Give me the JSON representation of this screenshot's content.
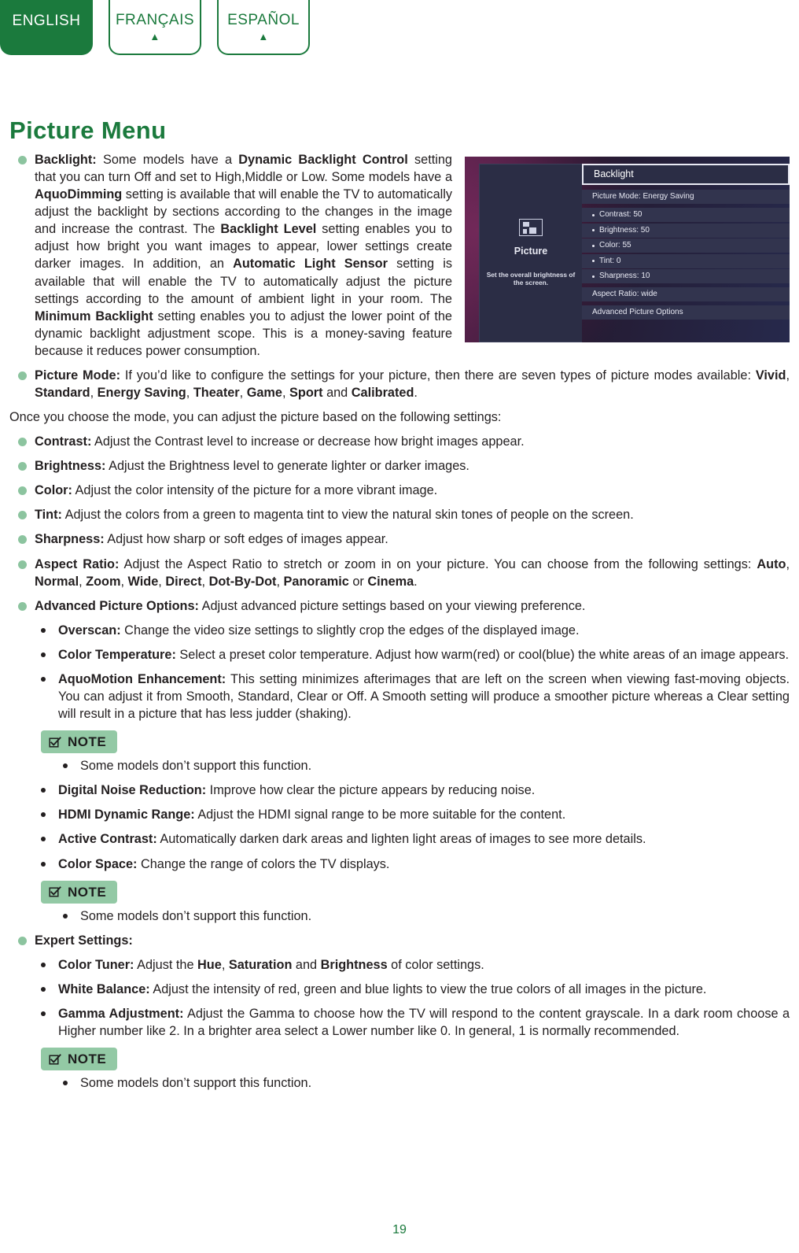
{
  "language_tabs": [
    {
      "label": "ENGLISH",
      "active": true,
      "arrow": "▲"
    },
    {
      "label": "FRANÇAIS",
      "active": false,
      "arrow": "▲"
    },
    {
      "label": "ESPAÑOL",
      "active": false,
      "arrow": "▲"
    }
  ],
  "page": {
    "title": "Picture Menu",
    "number": "19"
  },
  "colors": {
    "brand_green": "#1b7a3d",
    "bullet_green": "#8cc49f",
    "note_badge_bg": "#93c9a5",
    "text": "#231f20"
  },
  "tv_screenshot": {
    "panel_label": "Picture",
    "panel_description": "Set the overall brightness of the screen.",
    "panel_icon": "picture-mode-icon",
    "highlighted_item": "Backlight",
    "rows": [
      {
        "label": "Picture Mode: Energy Saving",
        "bulleted": false,
        "group_start": true
      },
      {
        "label": "Contrast: 50",
        "bulleted": true,
        "group_start": true
      },
      {
        "label": "Brightness: 50",
        "bulleted": true,
        "group_start": false
      },
      {
        "label": "Color: 55",
        "bulleted": true,
        "group_start": false
      },
      {
        "label": "Tint: 0",
        "bulleted": true,
        "group_start": false
      },
      {
        "label": "Sharpness: 10",
        "bulleted": true,
        "group_start": false
      },
      {
        "label": "Aspect Ratio: wide",
        "bulleted": false,
        "group_start": true
      },
      {
        "label": "Advanced Picture Options",
        "bulleted": false,
        "group_start": true
      }
    ]
  },
  "body": {
    "backlight": {
      "term": "Backlight:",
      "text_1": " Some models have a ",
      "bold_1": "Dynamic Backlight Control",
      "text_2": " setting that you can turn Off and set to High,Middle  or Low. Some models have a ",
      "bold_2": "AquoDimming",
      "text_3": " setting is available that will enable the TV to automatically adjust the backlight by sections according to the changes in the image and increase the contrast. The ",
      "bold_3": "Backlight Level",
      "text_4": " setting enables you to adjust how bright you want images to appear, lower settings create darker images. In addition, an ",
      "bold_4": "Automatic Light Sensor",
      "text_5": " setting is available that will enable the TV to automatically adjust the picture settings according to the amount of ambient light in your room. The ",
      "bold_5": "Minimum Backlight",
      "text_6": " setting enables you to adjust the lower point of the dynamic backlight adjustment scope. This is a money-saving feature because it reduces power consumption."
    },
    "picture_mode": {
      "term": "Picture Mode:",
      "text_1": " If you’d like to configure the settings for your picture, then there are seven types of picture modes available: ",
      "modes": [
        "Vivid",
        "Standard",
        "Energy Saving",
        "Theater",
        "Game",
        "Sport",
        "Calibrated"
      ],
      "tail": "."
    },
    "intro_line": "Once you choose the mode, you can adjust the picture based on the following settings:",
    "settings": [
      {
        "term": "Contrast:",
        "text": " Adjust the Contrast level to increase or decrease how bright images appear."
      },
      {
        "term": "Brightness:",
        "text": " Adjust the Brightness level to generate lighter or darker images."
      },
      {
        "term": "Color:",
        "text": " Adjust the color intensity of the picture for a more vibrant image."
      },
      {
        "term": "Tint:",
        "text": " Adjust the colors from a green to magenta tint to view the natural skin tones of people on the screen."
      },
      {
        "term": "Sharpness:",
        "text": " Adjust how sharp or soft edges of images appear."
      }
    ],
    "aspect_ratio": {
      "term": "Aspect Ratio:",
      "text_1": " Adjust the Aspect Ratio to stretch or zoom in on your picture. You can choose from the following settings: ",
      "options": [
        "Auto",
        "Normal",
        "Zoom",
        "Wide",
        "Direct",
        "Dot-By-Dot",
        "Panoramic",
        "Cinema"
      ],
      "tail": "."
    },
    "advanced": {
      "term": "Advanced Picture Options:",
      "text": " Adjust advanced picture settings based on your viewing preference."
    },
    "advanced_items": [
      {
        "term": "Overscan:",
        "text": " Change the video size settings to slightly crop the edges of the displayed image."
      },
      {
        "term": "Color Temperature:",
        "text": " Select a preset color temperature. Adjust how warm(red) or cool(blue) the white areas of an image appears."
      },
      {
        "term": "AquoMotion Enhancement:",
        "text": " This setting minimizes afterimages that are left on the screen when viewing fast-moving objects. You can adjust it from Smooth, Standard, Clear or Off. A Smooth setting will produce a smoother picture whereas a Clear setting will result in a picture that has less judder (shaking)."
      }
    ],
    "note_label": "NOTE",
    "note_text": "Some models don’t support this function.",
    "advanced_items_2": [
      {
        "term": "Digital Noise Reduction:",
        "text": " Improve how clear the picture appears by reducing noise."
      },
      {
        "term": "HDMI Dynamic Range:",
        "text": " Adjust the HDMI signal range to be more suitable for the content."
      },
      {
        "term": "Active Contrast:",
        "text": " Automatically darken dark areas and lighten light areas of images to see more details."
      },
      {
        "term": "Color Space:",
        "text": " Change the range of colors the TV displays."
      }
    ],
    "expert": {
      "term": "Expert Settings:",
      "text": ""
    },
    "expert_items": {
      "color_tuner": {
        "term": "Color Tuner:",
        "text_1": " Adjust the ",
        "bold_1": "Hue",
        "text_2": ", ",
        "bold_2": "Saturation",
        "text_3": " and ",
        "bold_3": "Brightness",
        "text_4": " of color settings."
      },
      "white_balance": {
        "term": "White Balance:",
        "text": " Adjust the intensity of red, green and blue lights to view the true colors of all images in the picture."
      },
      "gamma": {
        "term": "Gamma Adjustment:",
        "text": " Adjust the Gamma to choose how the TV will respond to the content grayscale. In a dark room choose a Higher number like 2. In a brighter area select a Lower number like 0. In general, 1 is normally recommended."
      }
    }
  }
}
